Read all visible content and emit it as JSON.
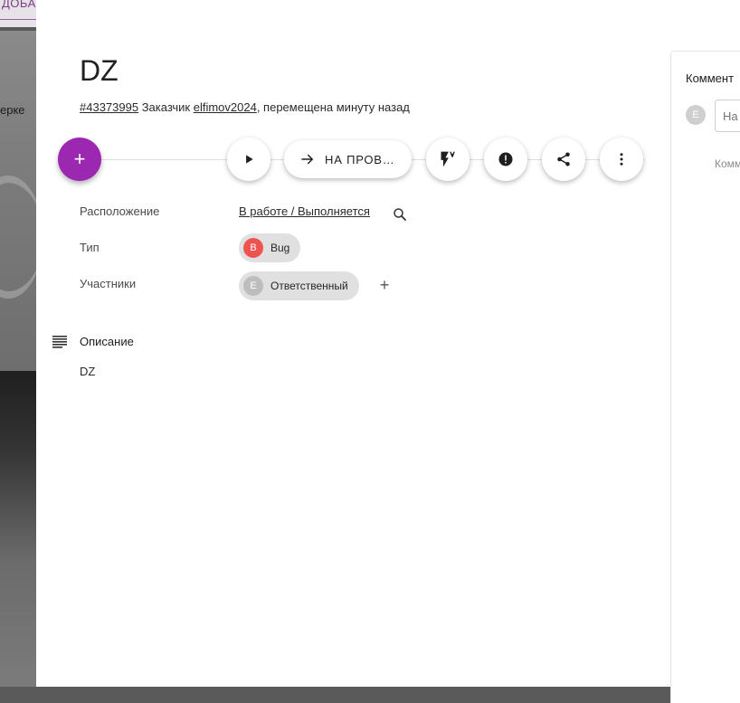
{
  "background": {
    "top_tab_label": "ДОБА",
    "side_text": "ерке"
  },
  "task": {
    "title": "DZ",
    "number": "#43373995",
    "customer_label": "Заказчик",
    "customer_name": "elfimov2024",
    "moved_text": ", перемещена минуту назад"
  },
  "toolbar": {
    "add_label": "+",
    "move_button_label": "НА ПРОВ…"
  },
  "fields": {
    "location_label": "Расположение",
    "location_value": "В работе / Выполняется",
    "type_label": "Тип",
    "type_value": "Bug",
    "type_avatar": "B",
    "participants_label": "Участники",
    "participant_role": "Ответственный",
    "participant_avatar": "E"
  },
  "description": {
    "title": "Описание",
    "text": "DZ"
  },
  "comments": {
    "title": "Коммент",
    "avatar": "E",
    "input_placeholder": "На",
    "empty_text": "Комм"
  },
  "colors": {
    "accent": "#9c27b0",
    "bug_avatar": "#ef5350",
    "user_avatar": "#bdbdbd"
  },
  "icons": [
    "play-icon",
    "arrow-right-icon",
    "flash-auto-icon",
    "alert-icon",
    "share-icon",
    "more-vert-icon",
    "search-icon",
    "plus-icon",
    "description-icon"
  ]
}
